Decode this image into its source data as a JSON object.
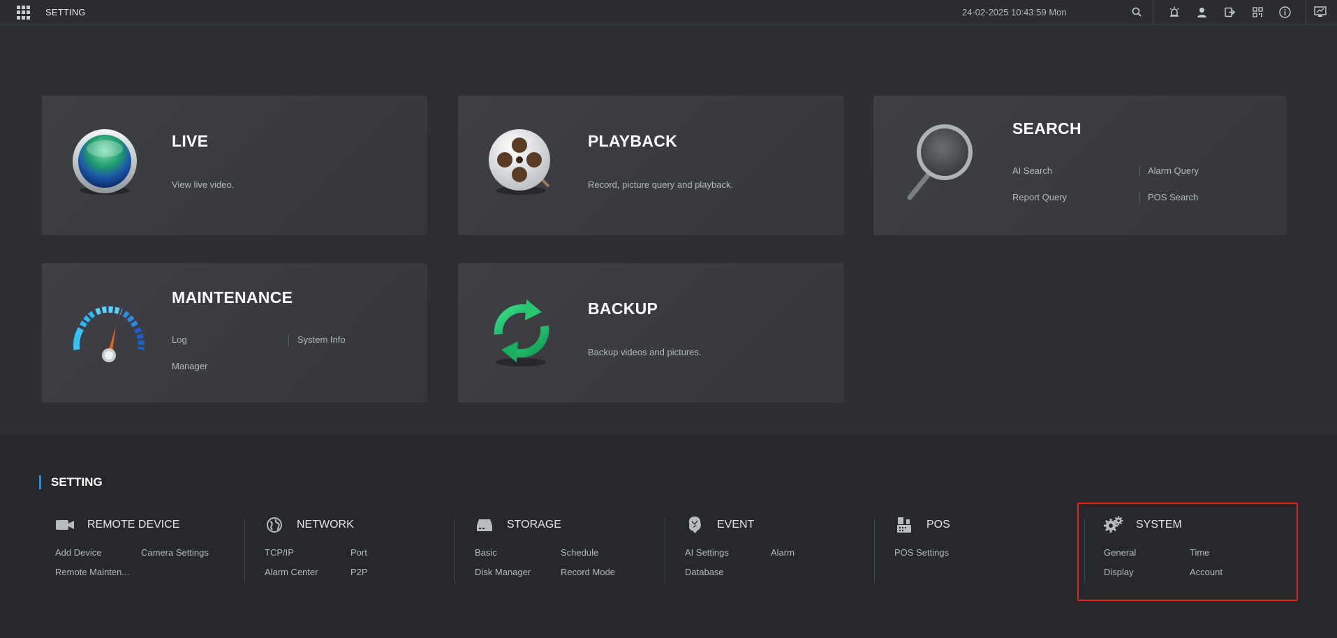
{
  "topbar": {
    "title": "SETTING",
    "datetime": "24-02-2025 10:43:59 Mon",
    "icons": [
      "grid-menu-icon",
      "search-icon",
      "alarm-icon",
      "user-icon",
      "logout-icon",
      "qr-code-icon",
      "info-icon",
      "display-icon"
    ]
  },
  "cards": {
    "live": {
      "title": "LIVE",
      "desc": "View live video."
    },
    "playback": {
      "title": "PLAYBACK",
      "desc": "Record, picture query and playback."
    },
    "search": {
      "title": "SEARCH",
      "links": [
        "AI Search",
        "Alarm Query",
        "Report Query",
        "POS Search"
      ]
    },
    "maintenance": {
      "title": "MAINTENANCE",
      "links": [
        "Log",
        "System Info",
        "Manager"
      ]
    },
    "backup": {
      "title": "BACKUP",
      "desc": "Backup videos and pictures."
    }
  },
  "settings": {
    "title": "SETTING",
    "groups": [
      {
        "title": "REMOTE DEVICE",
        "icon": "camera-icon",
        "items": [
          "Add Device",
          "Camera Settings",
          "Remote Mainten..."
        ]
      },
      {
        "title": "NETWORK",
        "icon": "globe-icon",
        "items": [
          "TCP/IP",
          "Port",
          "Alarm Center",
          "P2P"
        ]
      },
      {
        "title": "STORAGE",
        "icon": "hard-drive-icon",
        "items": [
          "Basic",
          "Schedule",
          "Disk Manager",
          "Record Mode"
        ]
      },
      {
        "title": "EVENT",
        "icon": "event-icon",
        "items": [
          "AI Settings",
          "Alarm",
          "Database"
        ]
      },
      {
        "title": "POS",
        "icon": "pos-terminal-icon",
        "items": [
          "POS Settings"
        ]
      },
      {
        "title": "SYSTEM",
        "icon": "gears-icon",
        "items": [
          "General",
          "Time",
          "Display",
          "Account"
        ]
      }
    ]
  },
  "colors": {
    "accent": "#1e8fe1",
    "highlight": "#e0241b",
    "background": "#2c2e32",
    "card": "#3b3d42"
  }
}
